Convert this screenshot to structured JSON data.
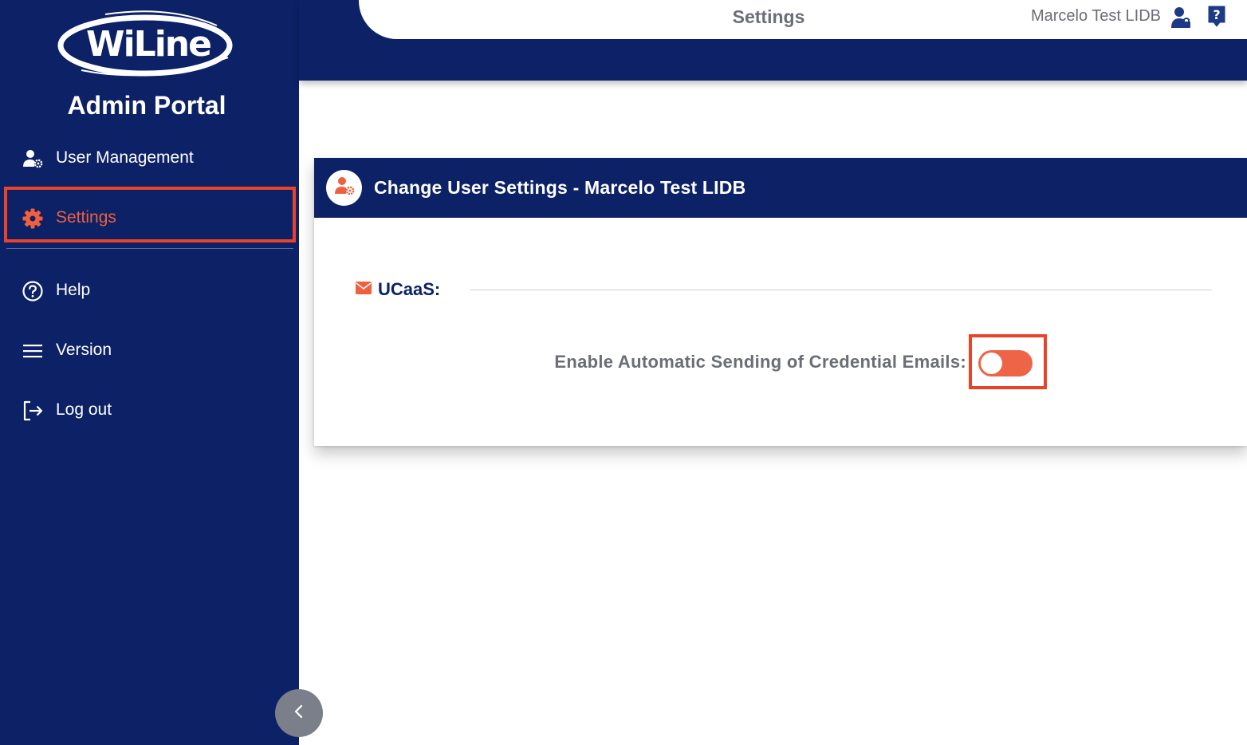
{
  "brand": {
    "logo_text": "WiLine",
    "portal_title": "Admin Portal"
  },
  "sidebar": {
    "items": [
      {
        "label": "User Management",
        "icon": "user-gear-icon",
        "active": false
      },
      {
        "label": "Settings",
        "icon": "gear-icon",
        "active": true
      },
      {
        "label": "Help",
        "icon": "question-circle-icon",
        "active": false
      },
      {
        "label": "Version",
        "icon": "menu-lines-icon",
        "active": false
      },
      {
        "label": "Log out",
        "icon": "logout-icon",
        "active": false
      }
    ],
    "collapse_icon": "chevron-left-icon"
  },
  "header": {
    "title": "Settings",
    "user_name": "Marcelo Test LIDB",
    "user_icon": "user-lock-icon",
    "help_icon": "question-bubble-icon"
  },
  "card": {
    "title": "Change User Settings - Marcelo Test LIDB",
    "avatar_icon": "user-gear-icon",
    "section": {
      "icon": "envelope-icon",
      "label": "UCaaS:"
    },
    "setting": {
      "label": "Enable Automatic Sending of Credential Emails:",
      "enabled": false
    }
  },
  "colors": {
    "navy": "#0c2166",
    "accent": "#f0603e",
    "toggle": "#ee6446",
    "highlight_outline": "#e8442a",
    "muted_text": "#6b6e76"
  }
}
